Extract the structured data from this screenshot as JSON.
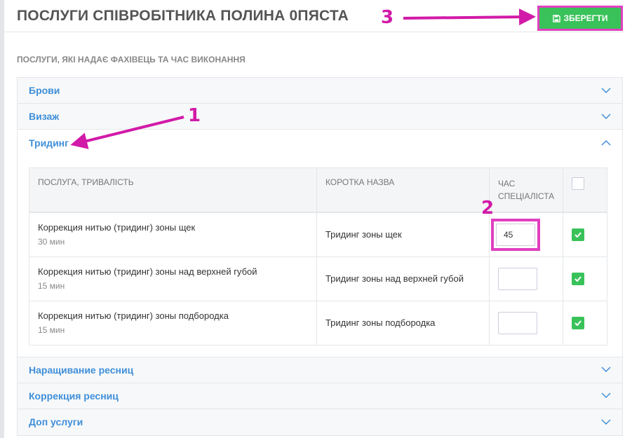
{
  "page": {
    "title": "ПОСЛУГИ СПІВРОБІТНИКА ПОЛИНА 0ПЯСТА",
    "save_label": "ЗБЕРЕГТИ",
    "subtitle": "ПОСЛУГИ, ЯКІ НАДАЄ ФАХІВЕЦЬ ТА ЧАС ВИКОНАННЯ"
  },
  "categories_top": [
    {
      "label": "Брови"
    },
    {
      "label": "Визаж"
    }
  ],
  "open_category": {
    "label": "Тридинг",
    "columns": {
      "service": "ПОСЛУГА, ТРИВАЛІСТЬ",
      "short_name": "КОРОТКА НАЗВА",
      "time": "ЧАС СПЕЦІАЛІСТА"
    },
    "rows": [
      {
        "name": "Коррекция нитью (тридинг) зоны щек",
        "duration": "30 мин",
        "short": "Тридинг зоны щек",
        "time": "45",
        "checked": true
      },
      {
        "name": "Коррекция нитью (тридинг) зоны над верхней губой",
        "duration": "15 мин",
        "short": "Тридинг зоны над верхней губой",
        "time": "",
        "checked": true
      },
      {
        "name": "Коррекция нитью (тридинг) зоны подбородка",
        "duration": "15 мин",
        "short": "Тридинг зоны подбородка",
        "time": "",
        "checked": true
      }
    ]
  },
  "categories_bottom": [
    {
      "label": "Наращивание ресниц"
    },
    {
      "label": "Коррекция ресниц"
    },
    {
      "label": "Доп услуги"
    }
  ],
  "annotations": {
    "one": "1",
    "two": "2",
    "three": "3"
  },
  "colors": {
    "accent": "#3f8fd9",
    "save": "#3ac25a",
    "annotation": "#d21aa8"
  }
}
